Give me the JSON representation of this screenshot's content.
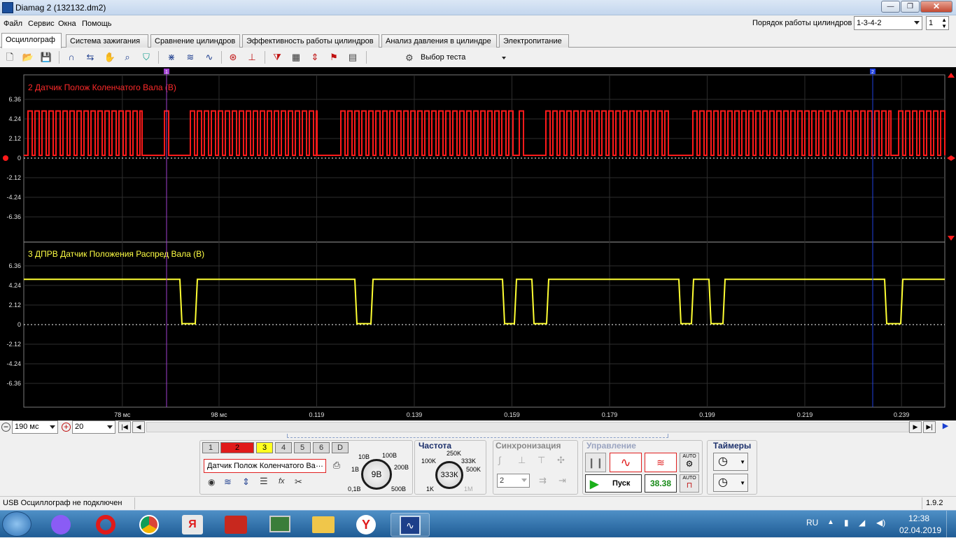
{
  "window": {
    "title": "Diamag 2 (132132.dm2)",
    "min": "—",
    "max": "❐",
    "close": "✕"
  },
  "menu": [
    "Файл",
    "Сервис",
    "Окна",
    "Помощь"
  ],
  "cylinders": {
    "label": "Порядок работы цилиндров",
    "order": "1-3-4-2",
    "count": "1"
  },
  "tabs": [
    "Осциллограф",
    "Система зажигания",
    "Сравнение цилиндров",
    "Эффективность работы цилиндров",
    "Анализ давления в цилиндре",
    "Электропитание"
  ],
  "test_select": "Выбор теста",
  "channels": [
    {
      "title": "2 Датчик Полож Коленчатого Вала (В)",
      "color": "#ff1a1a",
      "y_ticks": [
        "6.36",
        "4.24",
        "2.12",
        "0",
        "-2.12",
        "-4.24",
        "-6.36"
      ]
    },
    {
      "title": "3 ДПРВ Датчик Положения Распред Вала (В)",
      "color": "#ffff33",
      "y_ticks": [
        "6.36",
        "4.24",
        "2.12",
        "0",
        "-2.12",
        "-4.24",
        "-6.36"
      ]
    }
  ],
  "cursors": [
    "1",
    "2"
  ],
  "x_ticks": [
    "78 мс",
    "98 мс",
    "0.119",
    "0.139",
    "0.159",
    "0.179",
    "0.199",
    "0.219",
    "0.239"
  ],
  "chart_data": {
    "type": "line",
    "xlabel": "",
    "ylabel": "",
    "ylim": [
      -7.42,
      7.42
    ],
    "series": [
      {
        "name": "2 Датчик Полож Коленчатого Вала (В)",
        "high": 5.1,
        "low": 0.3,
        "signal": "square pulse train (crankshaft)"
      },
      {
        "name": "3 ДПРВ Датчик Положения Распред Вала (В)",
        "high": 4.9,
        "low": 0.1,
        "signal": "mostly high with low gaps (camshaft)"
      }
    ]
  },
  "scope": {
    "timebase": "190 мс",
    "scale": "20"
  },
  "panel": {
    "channel_buttons": [
      "1",
      "2",
      "3",
      "4",
      "5",
      "6",
      "D"
    ],
    "channel_name": "Датчик Полож Коленчатого Ва",
    "voltage": {
      "value": "9В",
      "marks": [
        "10В",
        "100В",
        "1В",
        "200В",
        "0,1В",
        "500В"
      ]
    },
    "frequency": {
      "title": "Частота",
      "value": "333К",
      "marks": [
        "250K",
        "100K",
        "333K",
        "500K",
        "1K",
        "1M"
      ]
    },
    "sync": {
      "title": "Синхронизация",
      "value": "2"
    },
    "control": {
      "title": "Управление",
      "start": "Пуск",
      "fps": "38.38",
      "auto": "AUTO"
    },
    "timers": {
      "title": "Таймеры"
    }
  },
  "status": {
    "text": "USB Осциллограф не подключен",
    "version": "1.9.2"
  },
  "tray": {
    "lang": "RU",
    "time": "12:38",
    "date": "02.04.2019"
  }
}
